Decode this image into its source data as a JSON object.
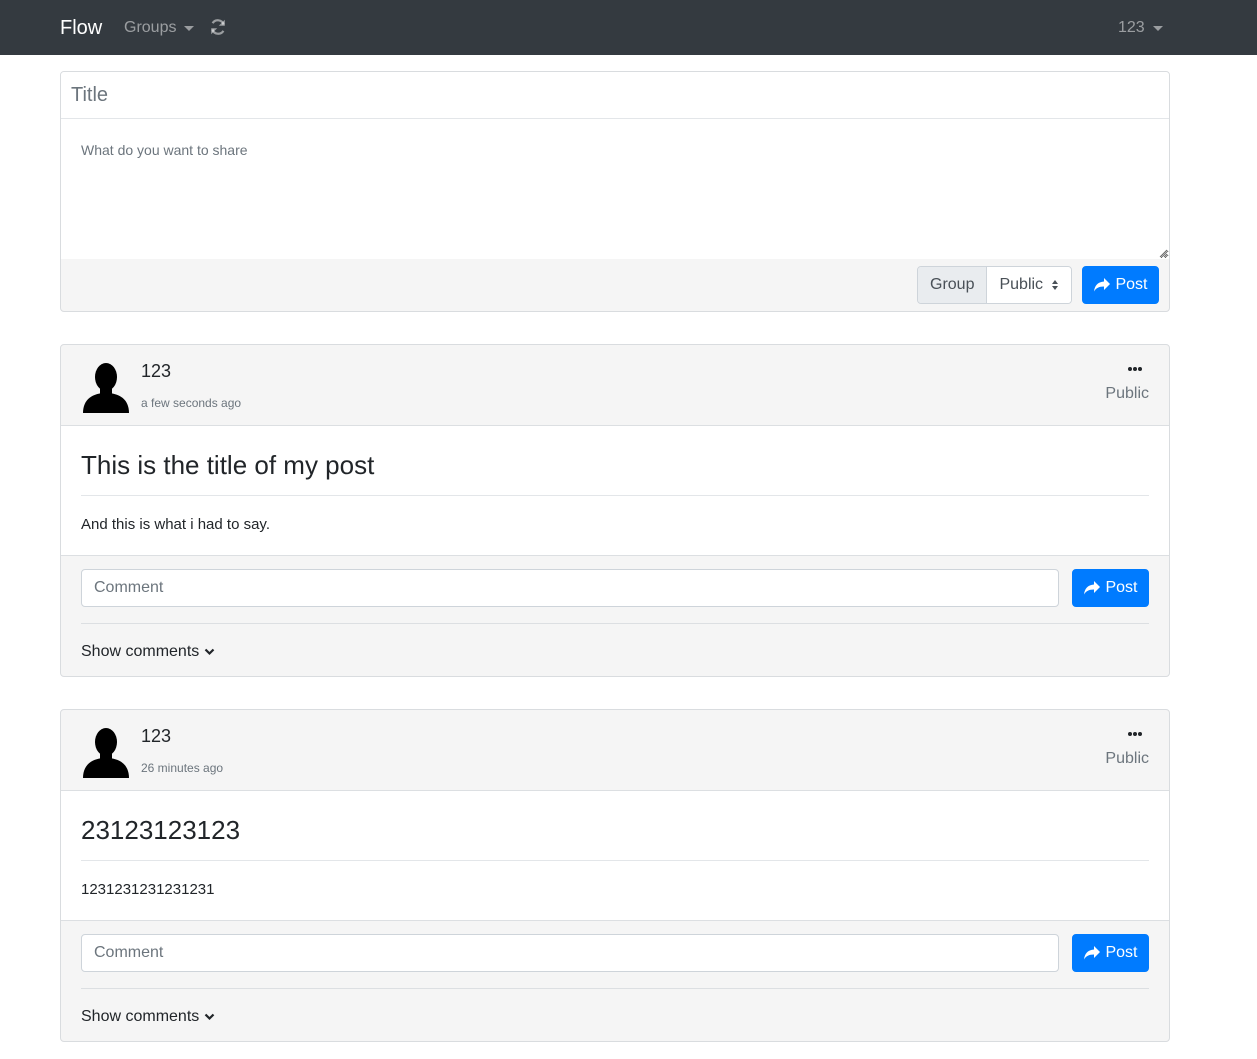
{
  "navbar": {
    "brand": "Flow",
    "groups_label": "Groups",
    "user_label": "123",
    "bg_color": "#343a40"
  },
  "compose": {
    "title_placeholder": "Title",
    "body_placeholder": "What do you want to share",
    "group_label": "Group",
    "group_value": "Public",
    "post_label": "Post"
  },
  "posts": [
    {
      "author": "123",
      "time": "a few seconds ago",
      "visibility": "Public",
      "title": "This is the title of my post",
      "text": "And this is what i had to say.",
      "comment_placeholder": "Comment",
      "post_label": "Post",
      "show_comments_label": "Show comments"
    },
    {
      "author": "123",
      "time": "26 minutes ago",
      "visibility": "Public",
      "title": "23123123123",
      "text": "1231231231231231",
      "comment_placeholder": "Comment",
      "post_label": "Post",
      "show_comments_label": "Show comments"
    }
  ],
  "colors": {
    "primary": "#007bff",
    "card_bg": "#f5f5f5"
  }
}
